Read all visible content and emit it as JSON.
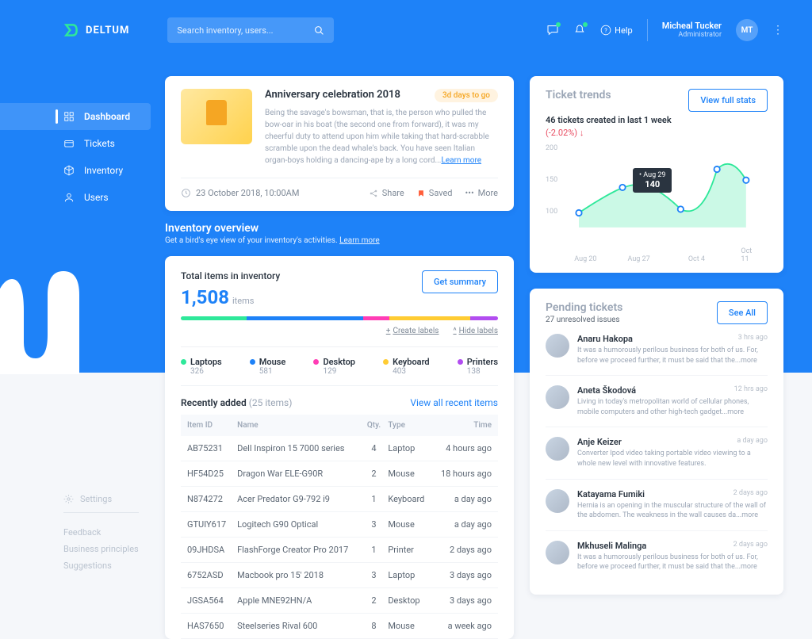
{
  "brand": "DELTUM",
  "search": {
    "placeholder": "Search inventory, users..."
  },
  "help_label": "Help",
  "user": {
    "name": "Micheal Tucker",
    "role": "Administrator",
    "initials": "MT"
  },
  "nav": [
    {
      "label": "Dashboard",
      "active": true
    },
    {
      "label": "Tickets"
    },
    {
      "label": "Inventory"
    },
    {
      "label": "Users"
    }
  ],
  "footer_nav": {
    "settings": "Settings",
    "links": [
      "Feedback",
      "Business principles",
      "Suggestions"
    ]
  },
  "anniv": {
    "title": "Anniversary celebration 2018",
    "badge": "3d days to go",
    "text": "Being the savage's bowsman, that is, the person who pulled the bow-oar in his boat (the second one from forward), it was my cheerful duty to attend upon him while taking that hard-scrabble scramble upon the dead whale's back. You have seen Italian organ-boys holding a dancing-ape by a long cord...",
    "learn": "Learn more",
    "date": "23 October 2018, 10:00AM",
    "actions": {
      "share": "Share",
      "saved": "Saved",
      "more": "More"
    }
  },
  "overview": {
    "title": "Inventory overview",
    "sub": "Get a bird's eye view of your inventory's activities. ",
    "learn": "Learn more"
  },
  "inventory": {
    "heading": "Total items in inventory",
    "count": "1,508",
    "unit": "items",
    "get_summary": "Get summary",
    "create_labels": "Create labels",
    "hide_labels": "Hide labels",
    "categories": [
      {
        "name": "Laptops",
        "count": "326",
        "color": "#2ee89a"
      },
      {
        "name": "Mouse",
        "count": "581",
        "color": "#1e82f8"
      },
      {
        "name": "Desktop",
        "count": "129",
        "color": "#ff3db5"
      },
      {
        "name": "Keyboard",
        "count": "403",
        "color": "#ffcc33"
      },
      {
        "name": "Printers",
        "count": "138",
        "color": "#b24df0"
      }
    ],
    "recent_label": "Recently added",
    "recent_count": "(25 items)",
    "view_all": "View all recent items",
    "cols": [
      "Item ID",
      "Name",
      "Qty.",
      "Type",
      "Time"
    ],
    "rows": [
      [
        "AB75231",
        "Dell Inspiron 15 7000 series",
        "4",
        "Laptop",
        "4 hours ago"
      ],
      [
        "HF54D25",
        "Dragon War ELE-G90R",
        "2",
        "Mouse",
        "18 hours ago"
      ],
      [
        "N874272",
        "Acer Predator G9-792 i9",
        "1",
        "Keyboard",
        "a day ago"
      ],
      [
        "GTUIY617",
        "Logitech G90 Optical",
        "3",
        "Mouse",
        "a day ago"
      ],
      [
        "09JHDSA",
        "FlashForge Creator Pro 2017",
        "1",
        "Printer",
        "2 days ago"
      ],
      [
        "6752ASD",
        "Macbook pro 15' 2018",
        "3",
        "Laptop",
        "3 days ago"
      ],
      [
        "JGSA564",
        "Apple MNE92HN/A",
        "2",
        "Desktop",
        "3 days ago"
      ],
      [
        "HAS7650",
        "Steelseries Rival 600",
        "8",
        "Mouse",
        "a week ago"
      ]
    ]
  },
  "trends": {
    "title": "Ticket trends",
    "view_stats": "View full stats",
    "sub": "46 tickets created in last 1 week",
    "pct": "(-2.02%)",
    "tooltip_date": "Aug 29",
    "tooltip_val": "140",
    "yticks": [
      "200",
      "150",
      "100"
    ],
    "xticks": [
      "Aug 20",
      "Aug 27",
      "Oct 4",
      "Oct 11"
    ]
  },
  "chart_data": {
    "type": "line",
    "x": [
      "Aug 20",
      "Aug 27",
      "Oct 4",
      "Oct 11"
    ],
    "values": [
      100,
      135,
      100,
      175
    ],
    "highlight": {
      "x": "Aug 29",
      "y": 140
    },
    "ylim": [
      100,
      200
    ],
    "title": "Ticket trends"
  },
  "pending": {
    "title": "Pending tickets",
    "sub": "27 unresolved issues",
    "see_all": "See All",
    "tickets": [
      {
        "name": "Anaru Hakopa",
        "time": "3 hrs ago",
        "text": "It was a humorously perilous business for both of us. For, before we proceed further, it must be said that the...more"
      },
      {
        "name": "Aneta Škodová",
        "time": "12 hrs ago",
        "text": "Living in today's metropolitan world of cellular phones, mobile computers and other high-tech gadget...more"
      },
      {
        "name": "Anje Keizer",
        "time": "a day ago",
        "text": "Converter Ipod video taking portable video viewing to a whole new level with innovative features."
      },
      {
        "name": "Katayama Fumiki",
        "time": "2 days ago",
        "text": "Hernia is an opening in the muscular structure of the wall of the abdomen. The weakness in the wall causes da...more"
      },
      {
        "name": "Mkhuseli Malinga",
        "time": "2 days ago",
        "text": "It was a humorously perilous business for both of us. For, before we proceed further, it must be said that the...more"
      }
    ]
  }
}
